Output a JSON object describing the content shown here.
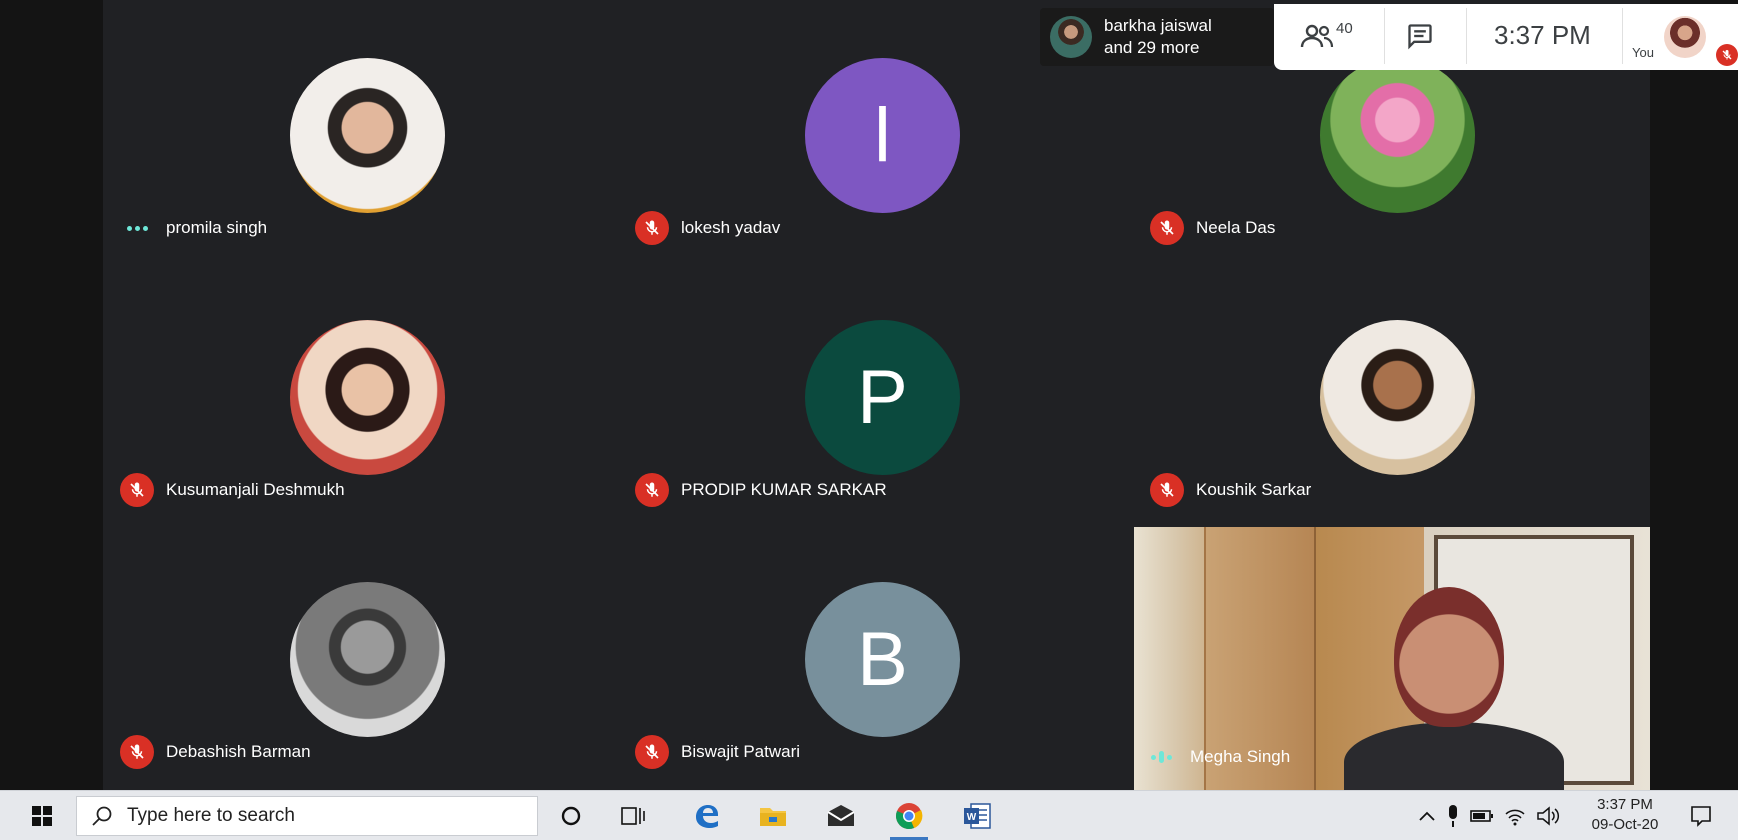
{
  "meeting": {
    "active_speaker": {
      "name": "barkha jaiswal",
      "more": "and 29 more"
    },
    "participant_count": "40",
    "clock": "3:37 PM",
    "you_label": "You"
  },
  "tiles": [
    {
      "name": "promila singh",
      "status": "speaking",
      "avatar_type": "photo",
      "avatar_color": "#e8dcd0"
    },
    {
      "name": "lokesh yadav",
      "status": "muted",
      "avatar_type": "letter",
      "letter": "l",
      "avatar_color": "#7e57c2"
    },
    {
      "name": "Neela Das",
      "status": "muted",
      "avatar_type": "photo",
      "avatar_color": "#4c8a3a"
    },
    {
      "name": "Kusumanjali Deshmukh",
      "status": "muted",
      "avatar_type": "photo",
      "avatar_color": "#c9493f"
    },
    {
      "name": "PRODIP KUMAR SARKAR",
      "status": "muted",
      "avatar_type": "letter",
      "letter": "P",
      "avatar_color": "#0b4a3e"
    },
    {
      "name": "Koushik Sarkar",
      "status": "muted",
      "avatar_type": "photo",
      "avatar_color": "#d7c1a0"
    },
    {
      "name": "Debashish Barman",
      "status": "muted",
      "avatar_type": "photo",
      "avatar_color": "#b0b0b0"
    },
    {
      "name": "Biswajit Patwari",
      "status": "muted",
      "avatar_type": "letter",
      "letter": "B",
      "avatar_color": "#78909c"
    }
  ],
  "video_tile": {
    "name": "Megha Singh",
    "status": "speaking"
  },
  "taskbar": {
    "search_placeholder": "Type here to search",
    "time": "3:37 PM",
    "date": "09-Oct-20",
    "apps": [
      "cortana-icon",
      "task-view-icon",
      "edge-icon",
      "file-explorer-icon",
      "mail-icon",
      "chrome-icon",
      "word-icon"
    ],
    "active_app": "chrome-icon"
  }
}
